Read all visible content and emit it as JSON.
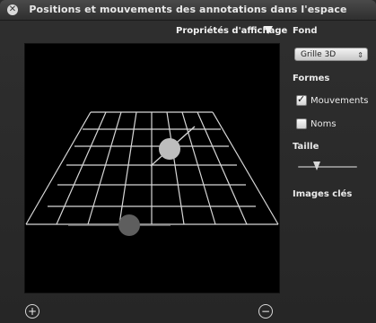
{
  "window": {
    "title": "Positions et mouvements des annotations dans l'espace",
    "close_symbol": "✕"
  },
  "viewport": {
    "display_properties_label": "Propriétés d'affichage",
    "display_properties_toggle": "triangle-down-icon"
  },
  "sidebar": {
    "fond_label": "Fond",
    "fond_select_value": "Grille 3D",
    "formes_label": "Formes",
    "mouvements_label": "Mouvements",
    "mouvements_checked": true,
    "noms_label": "Noms",
    "noms_checked": false,
    "taille_label": "Taille",
    "taille_value": 0.3,
    "images_cles_label": "Images clés"
  },
  "footer": {
    "add_symbol": "+",
    "remove_symbol": "−"
  },
  "colors": {
    "grid_line": "#d7d7d7",
    "sphere_light": "#bdbdbd",
    "sphere_dark": "#5e5e5e"
  }
}
